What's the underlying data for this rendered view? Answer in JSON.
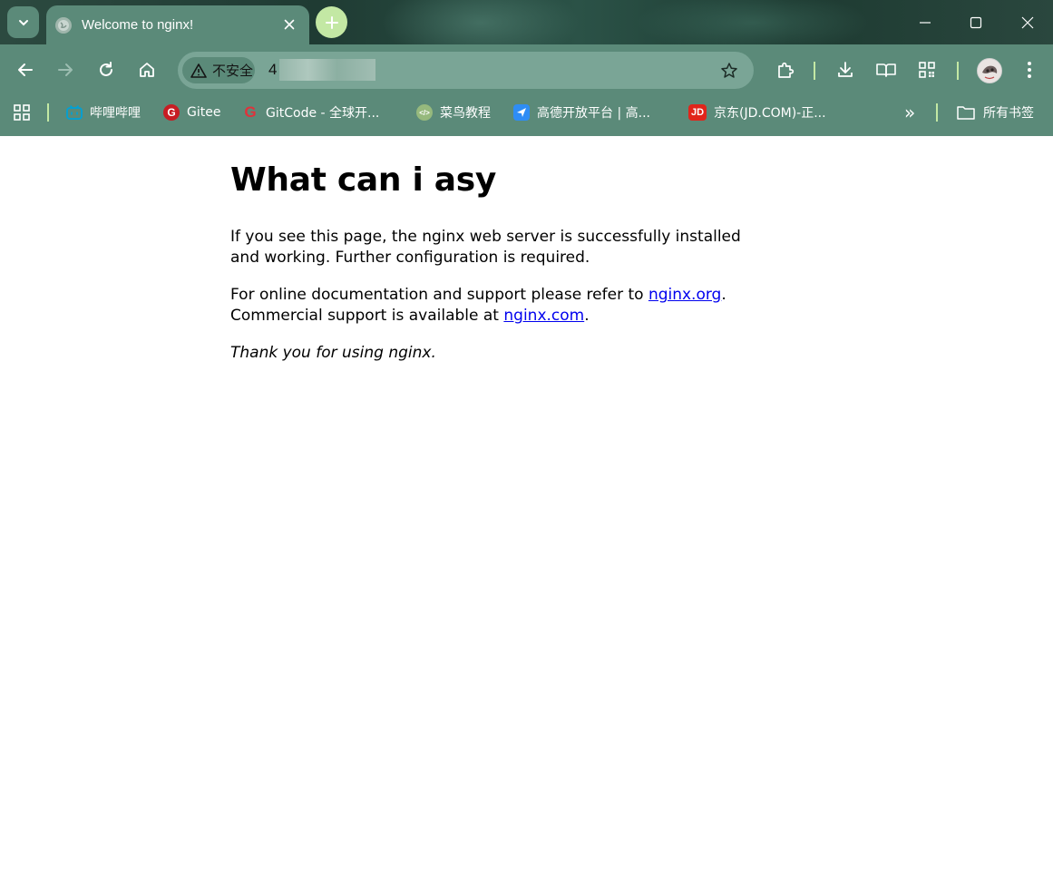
{
  "browser": {
    "tab": {
      "title": "Welcome to nginx!"
    },
    "omnibox": {
      "security_label": "不安全",
      "url_visible": "4"
    },
    "bookmarks": [
      {
        "label": "哔哩哔哩",
        "icon": "bilibili-icon"
      },
      {
        "label": "Gitee",
        "icon": "gitee-icon"
      },
      {
        "label": "GitCode - 全球开...",
        "icon": "gitcode-icon"
      },
      {
        "label": "菜鸟教程",
        "icon": "runoob-icon"
      },
      {
        "label": "高德开放平台 | 高...",
        "icon": "amap-icon"
      },
      {
        "label": "京东(JD.COM)-正...",
        "icon": "jd-icon"
      }
    ],
    "overflow_label": "»",
    "all_bookmarks_label": "所有书签"
  },
  "page": {
    "heading": "What can i asy",
    "para1": "If you see this page, the nginx web server is successfully installed and working. Further configuration is required.",
    "para2_prefix": "For online documentation and support please refer to ",
    "link_org": "nginx.org",
    "para2_mid": ".",
    "para2_line2_prefix": "Commercial support is available at ",
    "link_com": "nginx.com",
    "para2_end": ".",
    "thanks": "Thank you for using nginx."
  },
  "colors": {
    "frame": "#5b8a79",
    "omnibox": "#7aa596",
    "accent": "#c3e8a4",
    "link": "#0000ee"
  }
}
